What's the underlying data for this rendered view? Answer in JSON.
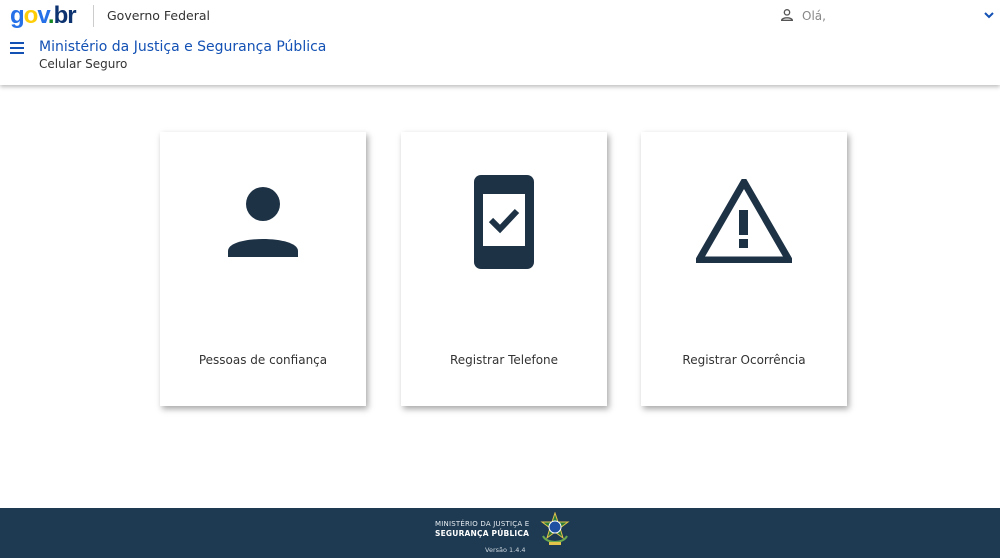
{
  "header": {
    "logo": {
      "g": "g",
      "o": "o",
      "v": "v",
      "dot": ".",
      "br": "br"
    },
    "government_label": "Governo Federal",
    "user_greeting": "Olá,",
    "ministry_title": "Ministério da Justiça e Segurança Pública",
    "app_subtitle": "Celular Seguro"
  },
  "cards": [
    {
      "label": "Pessoas de confiança",
      "icon": "person-icon"
    },
    {
      "label": "Registrar Telefone",
      "icon": "phone-check-icon"
    },
    {
      "label": "Registrar Ocorrência",
      "icon": "warning-icon"
    }
  ],
  "footer": {
    "line1": "MINISTÉRIO DA JUSTIÇA E",
    "line2": "SEGURANÇA PÚBLICA",
    "version": "Versão 1.4.4"
  },
  "colors": {
    "primary_blue": "#1351b4",
    "icon_dark": "#1e3246",
    "footer_bg": "#1e3a52"
  }
}
